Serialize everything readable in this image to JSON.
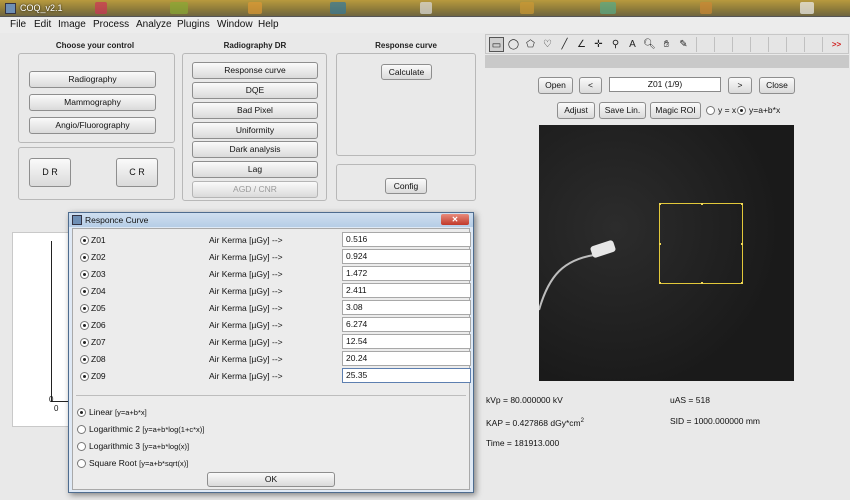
{
  "app": {
    "title": "COQ_v2.1"
  },
  "menu": [
    "File",
    "Edit",
    "Image",
    "Process",
    "Analyze",
    "Plugins",
    "Window",
    "Help"
  ],
  "left_panel": {
    "title": "Choose your control",
    "modality_buttons": [
      "Radiography",
      "Mammography",
      "Angio/Fluorography"
    ],
    "detector_buttons": [
      "D R",
      "C R"
    ]
  },
  "radiography_panel": {
    "title": "Radiography DR",
    "buttons": [
      "Response curve",
      "DQE",
      "Bad Pixel",
      "Uniformity",
      "Dark analysis",
      "Lag",
      "AGD / CNR"
    ]
  },
  "response_panel": {
    "title": "Response curve",
    "calculate_label": "Calculate",
    "config_label": "Config"
  },
  "toolbar": {
    "tools": [
      "rectangle-tool",
      "oval-tool",
      "polygon-tool",
      "freehand-tool",
      "line-tool",
      "angle-tool",
      "point-tool",
      "wand-tool",
      "text-tool",
      "magnifier-tool",
      "hand-tool",
      "color-picker-tool"
    ],
    "more_label": ">>"
  },
  "viewer_controls": {
    "open_label": "Open",
    "prev_label": "<",
    "image_name": "Z01 (1/9)",
    "next_label": ">",
    "close_label": "Close",
    "adjust_label": "Adjust",
    "save_lin_label": "Save Lin.",
    "magic_roi_label": "Magic ROI",
    "radio_linear_label": "y = x",
    "radio_affine_label": "y=a+b*x"
  },
  "image_info": {
    "kvp": "kVp = 80.000000 kV",
    "kap": "KAP = 0.427868 dGy*cm",
    "kap_sup": "2",
    "time": "Time = 181913.000",
    "uas": "uAS = 518",
    "sid": "SID = 1000.000000 mm"
  },
  "graph": {
    "y_zero": "0",
    "x_zero": "0"
  },
  "dialog": {
    "title": "Responce Curve",
    "rows": [
      {
        "id": "Z01",
        "label": "Air Kerma [µGy] -->",
        "value": "0.516"
      },
      {
        "id": "Z02",
        "label": "Air Kerma [µGy] -->",
        "value": "0.924"
      },
      {
        "id": "Z03",
        "label": "Air Kerma [µGy] -->",
        "value": "1.472"
      },
      {
        "id": "Z04",
        "label": "Air Kerma [µGy] -->",
        "value": "2.411"
      },
      {
        "id": "Z05",
        "label": "Air Kerma [µGy] -->",
        "value": "3.08"
      },
      {
        "id": "Z06",
        "label": "Air Kerma [µGy] -->",
        "value": "6.274"
      },
      {
        "id": "Z07",
        "label": "Air Kerma [µGy] -->",
        "value": "12.54"
      },
      {
        "id": "Z08",
        "label": "Air Kerma [µGy] -->",
        "value": "20.24"
      },
      {
        "id": "Z09",
        "label": "Air Kerma [µGy] -->",
        "value": "25.35"
      }
    ],
    "fits": [
      {
        "name": "Linear",
        "eq": "[y=a+b*x]",
        "selected": true
      },
      {
        "name": "Logarithmic 2",
        "eq": "[y=a+b*log(1+c*x)]",
        "selected": false
      },
      {
        "name": "Logarithmic 3",
        "eq": "[y=a+b*log(x)]",
        "selected": false
      },
      {
        "name": "Square Root",
        "eq": "[y=a+b*sqrt(x)]",
        "selected": false
      }
    ],
    "ok_label": "OK"
  }
}
